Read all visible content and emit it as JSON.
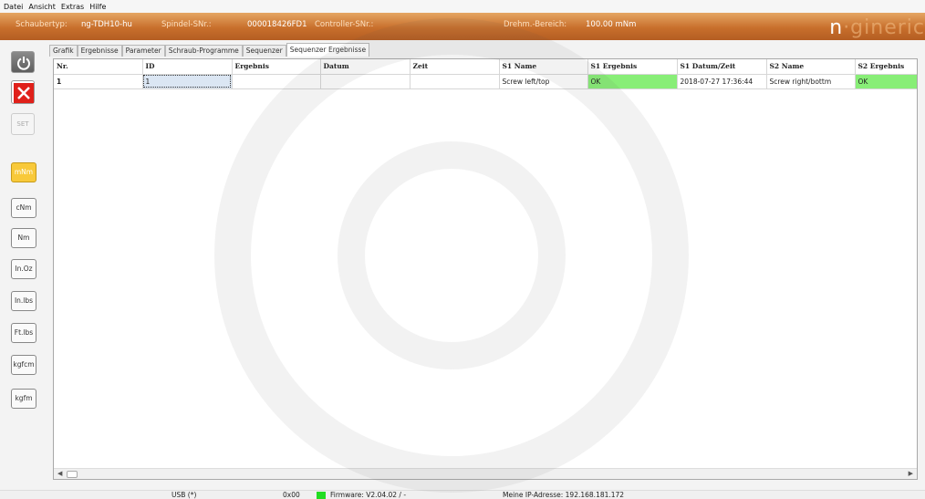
{
  "menu": [
    "Datei",
    "Ansicht",
    "Extras",
    "Hilfe"
  ],
  "header": {
    "schraubertyp_label": "Schaubertyp:",
    "schraubertyp_value": "ng-TDH10-hu",
    "spindel_label": "Spindel-SNr.:",
    "spindel_value": "000018426FD1",
    "controller_label": "Controller-SNr.:",
    "controller_value": "",
    "drehm_label": "Drehm.-Bereich:",
    "drehm_value": "100.00 mNm",
    "logo_n": "n",
    "logo_rest": "·gineric"
  },
  "toolbar": {
    "set_label": "SET",
    "units": [
      {
        "label": "mNm",
        "active": true
      },
      {
        "label": "cNm",
        "active": false
      },
      {
        "label": "Nm",
        "active": false
      },
      {
        "label": "In.Oz",
        "active": false
      },
      {
        "label": "In.lbs",
        "active": false
      },
      {
        "label": "Ft.lbs",
        "active": false
      },
      {
        "label": "kgfcm",
        "active": false
      },
      {
        "label": "kgfm",
        "active": false
      }
    ]
  },
  "tabs": [
    {
      "label": "Grafik",
      "active": false
    },
    {
      "label": "Ergebnisse",
      "active": false
    },
    {
      "label": "Parameter",
      "active": false
    },
    {
      "label": "Schraub-Programme",
      "active": false
    },
    {
      "label": "Sequenzer",
      "active": false
    },
    {
      "label": "Sequenzer Ergebnisse",
      "active": true
    }
  ],
  "table": {
    "columns": [
      "Nr.",
      "ID",
      "Ergebnis",
      "Datum",
      "Zeit",
      "S1 Name",
      "S1 Ergebnis",
      "S1 Datum/Zeit",
      "S2 Name",
      "S2 Ergebnis"
    ],
    "rows": [
      [
        "1",
        "1",
        "",
        "",
        "",
        "Screw left/top",
        "OK",
        "2018-07-27 17:36:44",
        "Screw right/bottm",
        "OK"
      ]
    ]
  },
  "status": {
    "usb": "USB (*)",
    "code": "0x00",
    "firmware": "Firmware: V2.04.02 / -",
    "ip": "Meine IP-Adresse: 192.168.181.172"
  },
  "colors": {
    "header_orange": "#c86f2c",
    "active_unit": "#f8c93a",
    "ok_green": "#88ee77",
    "status_green": "#22dd22",
    "close_red": "#e0201a"
  }
}
